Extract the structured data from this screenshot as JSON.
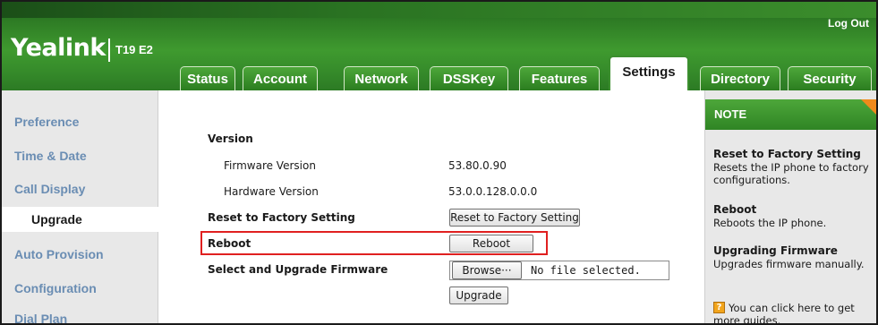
{
  "header": {
    "logo": "Yealink",
    "model": "T19 E2",
    "logout": "Log Out"
  },
  "tabs": [
    {
      "label": "Status"
    },
    {
      "label": "Account"
    },
    {
      "label": "Network"
    },
    {
      "label": "DSSKey"
    },
    {
      "label": "Features"
    },
    {
      "label": "Settings",
      "active": true
    },
    {
      "label": "Directory"
    },
    {
      "label": "Security"
    }
  ],
  "sidebar": {
    "items": [
      {
        "label": "Preference"
      },
      {
        "label": "Time & Date"
      },
      {
        "label": "Call Display"
      },
      {
        "label": "Upgrade",
        "active": true
      },
      {
        "label": "Auto Provision"
      },
      {
        "label": "Configuration"
      },
      {
        "label": "Dial Plan"
      }
    ]
  },
  "main": {
    "version_heading": "Version",
    "firmware_label": "Firmware Version",
    "firmware_value": "53.80.0.90",
    "hardware_label": "Hardware Version",
    "hardware_value": "53.0.0.128.0.0.0",
    "reset_label": "Reset to Factory Setting",
    "reset_button": "Reset to Factory Setting",
    "reboot_label": "Reboot",
    "reboot_button": "Reboot",
    "upgrade_label": "Select and Upgrade Firmware",
    "browse_button": "Browse···",
    "file_status": "No file selected.",
    "upgrade_button": "Upgrade",
    "highlight_color": "#e02020"
  },
  "note": {
    "title": "NOTE",
    "reset_title": "Reset to Factory Setting",
    "reset_text": "Resets the IP phone to factory configurations.",
    "reboot_title": "Reboot",
    "reboot_text": "Reboots the IP phone.",
    "upgrade_title": "Upgrading Firmware",
    "upgrade_text": "Upgrades firmware manually.",
    "help_icon": "?",
    "help_text": "You can click here to get more guides."
  },
  "colors": {
    "brand_green": "#3c8f2f",
    "nav_link": "#6a8db3",
    "note_corner": "#f08a1c"
  }
}
